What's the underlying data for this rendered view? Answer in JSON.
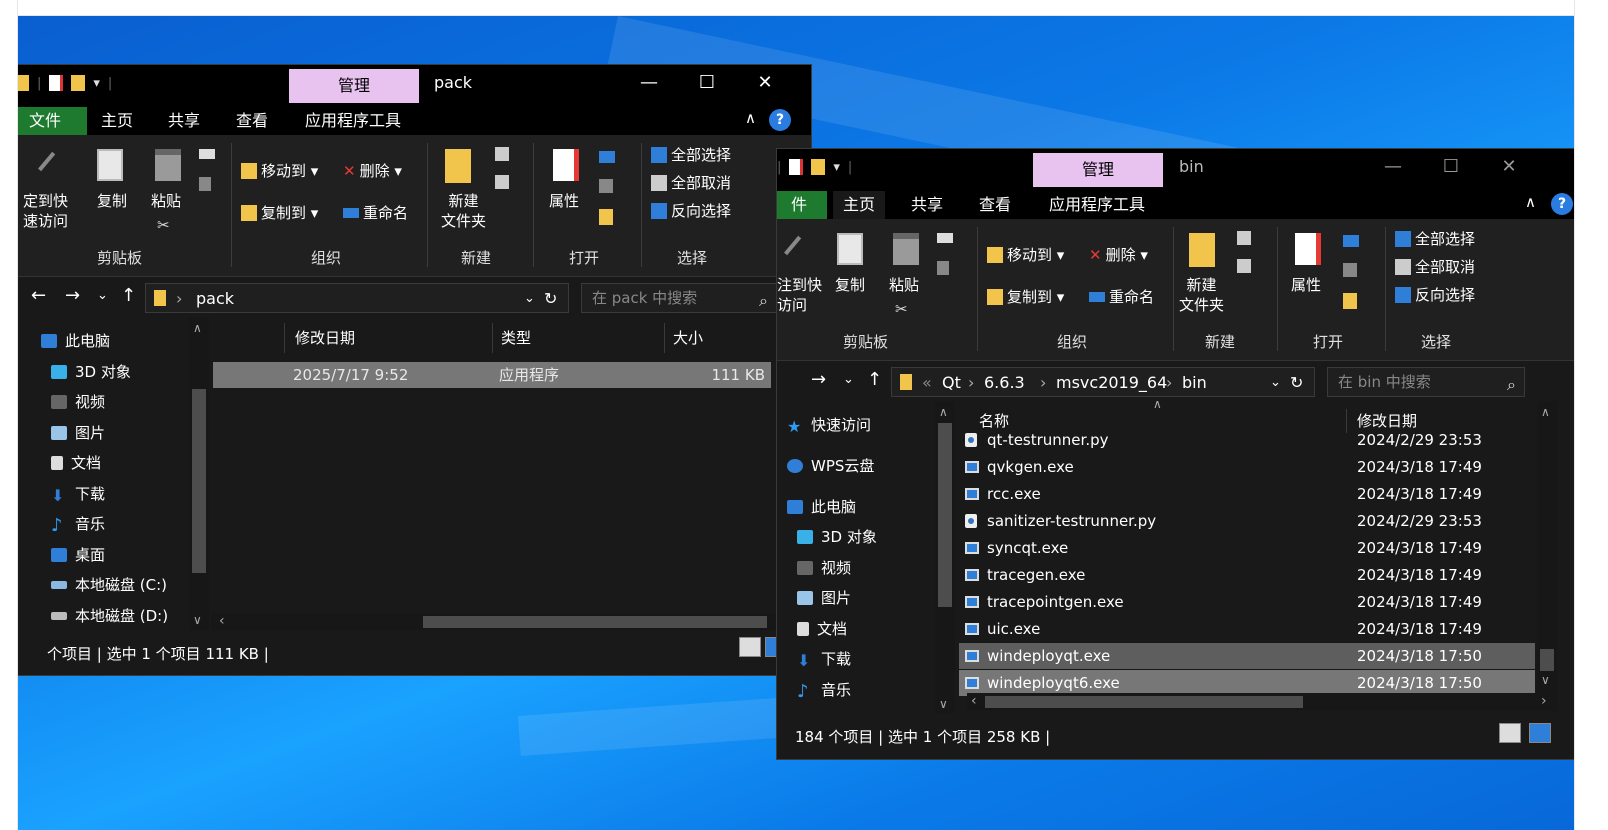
{
  "pack_window": {
    "manage_tab": "管理",
    "title": "pack",
    "menu": {
      "file": "文件",
      "home": "主页",
      "share": "共享",
      "view": "查看",
      "app_tools": "应用程序工具"
    },
    "ribbon": {
      "pin_line1": "定到快",
      "pin_line2": "速访问",
      "copy": "复制",
      "paste": "粘贴",
      "move_to": "移动到",
      "delete": "删除",
      "copy_to": "复制到",
      "rename": "重命名",
      "new_folder_line1": "新建",
      "new_folder_line2": "文件夹",
      "properties": "属性",
      "select_all": "全部选择",
      "select_none": "全部取消",
      "invert_selection": "反向选择",
      "groups": {
        "clipboard": "剪贴板",
        "organize": "组织",
        "new": "新建",
        "open": "打开",
        "select": "选择"
      }
    },
    "address": {
      "folder": "pack",
      "search_placeholder": "在 pack 中搜索"
    },
    "nav_items": [
      "此电脑",
      "3D 对象",
      "视频",
      "图片",
      "文档",
      "下载",
      "音乐",
      "桌面",
      "本地磁盘 (C:)",
      "本地磁盘 (D:)"
    ],
    "columns": {
      "date": "修改日期",
      "type": "类型",
      "size": "大小"
    },
    "rows": [
      {
        "date": "2025/7/17 9:52",
        "type": "应用程序",
        "size": "111 KB"
      }
    ],
    "status": "个项目  |  选中 1 个项目  111 KB  |"
  },
  "bin_window": {
    "manage_tab": "管理",
    "title": "bin",
    "menu": {
      "file": "件",
      "home": "主页",
      "share": "共享",
      "view": "查看",
      "app_tools": "应用程序工具"
    },
    "ribbon": {
      "pin_line1": "注到快",
      "pin_line2": "访问",
      "copy": "复制",
      "paste": "粘贴",
      "move_to": "移动到",
      "delete": "删除",
      "copy_to": "复制到",
      "rename": "重命名",
      "new_folder_line1": "新建",
      "new_folder_line2": "文件夹",
      "properties": "属性",
      "select_all": "全部选择",
      "select_none": "全部取消",
      "invert_selection": "反向选择",
      "groups": {
        "clipboard": "剪贴板",
        "organize": "组织",
        "new": "新建",
        "open": "打开",
        "select": "选择"
      }
    },
    "address": {
      "crumb_overflow": "«",
      "crumb1": "Qt",
      "crumb2": "6.6.3",
      "crumb3": "msvc2019_64",
      "crumb4": "bin",
      "search_placeholder": "在 bin 中搜索"
    },
    "nav_items": [
      "快速访问",
      "WPS云盘",
      "此电脑",
      "3D 对象",
      "视频",
      "图片",
      "文档",
      "下载",
      "音乐"
    ],
    "columns": {
      "name": "名称",
      "date": "修改日期"
    },
    "rows": [
      {
        "name": "qt-testrunner.py",
        "date": "2024/2/29 23:53",
        "kind": "py"
      },
      {
        "name": "qvkgen.exe",
        "date": "2024/3/18 17:49",
        "kind": "exe"
      },
      {
        "name": "rcc.exe",
        "date": "2024/3/18 17:49",
        "kind": "exe"
      },
      {
        "name": "sanitizer-testrunner.py",
        "date": "2024/2/29 23:53",
        "kind": "py"
      },
      {
        "name": "syncqt.exe",
        "date": "2024/3/18 17:49",
        "kind": "exe"
      },
      {
        "name": "tracegen.exe",
        "date": "2024/3/18 17:49",
        "kind": "exe"
      },
      {
        "name": "tracepointgen.exe",
        "date": "2024/3/18 17:49",
        "kind": "exe"
      },
      {
        "name": "uic.exe",
        "date": "2024/3/18 17:49",
        "kind": "exe"
      },
      {
        "name": "windeployqt.exe",
        "date": "2024/3/18 17:50",
        "kind": "exe"
      },
      {
        "name": "windeployqt6.exe",
        "date": "2024/3/18 17:50",
        "kind": "exe"
      }
    ],
    "status": "184 个项目  |  选中 1 个项目  258 KB  |"
  },
  "icons": {
    "minimize": "—",
    "maximize": "☐",
    "close": "✕",
    "back": "←",
    "forward": "→",
    "recent": "⌄",
    "up": "↑",
    "refresh": "↻",
    "search": "⌕",
    "chevron": "›",
    "collapse": "∧",
    "help": "?"
  }
}
